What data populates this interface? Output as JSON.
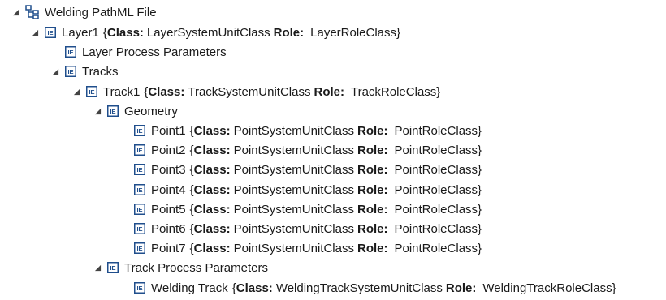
{
  "colors": {
    "icon_blue": "#1f4e8c",
    "toggle": "#444444",
    "text": "#1a1a1a"
  },
  "root": {
    "label": "Welding PathML File",
    "icon": "hierarchy-icon"
  },
  "nodes": {
    "layer1": {
      "name": "Layer1",
      "class_key": "Class:",
      "class": "LayerSystemUnitClass",
      "role_key": "Role:",
      "role": "LayerRoleClass",
      "open": "{",
      "close": "}"
    },
    "layer_params": {
      "name": "Layer Process Parameters"
    },
    "tracks": {
      "name": "Tracks"
    },
    "track1": {
      "name": "Track1",
      "class_key": "Class:",
      "class": "TrackSystemUnitClass",
      "role_key": "Role:",
      "role": "TrackRoleClass",
      "open": "{",
      "close": "}"
    },
    "geometry": {
      "name": "Geometry"
    },
    "points": [
      {
        "name": "Point1",
        "class_key": "Class:",
        "class": "PointSystemUnitClass",
        "role_key": "Role:",
        "role": "PointRoleClass",
        "open": "{",
        "close": "}"
      },
      {
        "name": "Point2",
        "class_key": "Class:",
        "class": "PointSystemUnitClass",
        "role_key": "Role:",
        "role": "PointRoleClass",
        "open": "{",
        "close": "}"
      },
      {
        "name": "Point3",
        "class_key": "Class:",
        "class": "PointSystemUnitClass",
        "role_key": "Role:",
        "role": "PointRoleClass",
        "open": "{",
        "close": "}"
      },
      {
        "name": "Point4",
        "class_key": "Class:",
        "class": "PointSystemUnitClass",
        "role_key": "Role:",
        "role": "PointRoleClass",
        "open": "{",
        "close": "}"
      },
      {
        "name": "Point5",
        "class_key": "Class:",
        "class": "PointSystemUnitClass",
        "role_key": "Role:",
        "role": "PointRoleClass",
        "open": "{",
        "close": "}"
      },
      {
        "name": "Point6",
        "class_key": "Class:",
        "class": "PointSystemUnitClass",
        "role_key": "Role:",
        "role": "PointRoleClass",
        "open": "{",
        "close": "}"
      },
      {
        "name": "Point7",
        "class_key": "Class:",
        "class": "PointSystemUnitClass",
        "role_key": "Role:",
        "role": "PointRoleClass",
        "open": "{",
        "close": "}"
      }
    ],
    "track_params": {
      "name": "Track Process Parameters"
    },
    "welding_track": {
      "name": "Welding Track",
      "class_key": "Class:",
      "class": "WeldingTrackSystemUnitClass",
      "role_key": "Role:",
      "role": "WeldingTrackRoleClass",
      "open": "{",
      "close": "}"
    }
  }
}
